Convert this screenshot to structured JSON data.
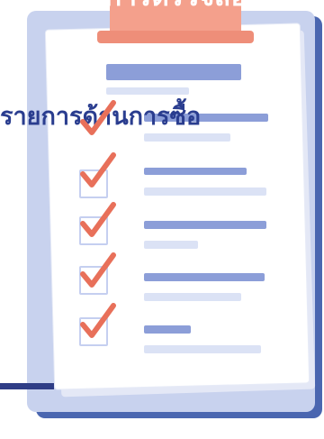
{
  "banner": {
    "title": "รายการตรวจสอบ"
  },
  "document": {
    "heading": "รายการด้านการซื้อ"
  },
  "checklist": {
    "items": [
      {
        "checked": true
      },
      {
        "checked": true
      },
      {
        "checked": true
      },
      {
        "checked": true
      },
      {
        "checked": true
      }
    ]
  },
  "colors": {
    "board_blue": "#4a66b0",
    "frame_light_blue": "#c8d2ee",
    "clip_salmon": "#f4a08c",
    "check_red": "#e8705a",
    "heading_navy": "#2a3d8f"
  }
}
